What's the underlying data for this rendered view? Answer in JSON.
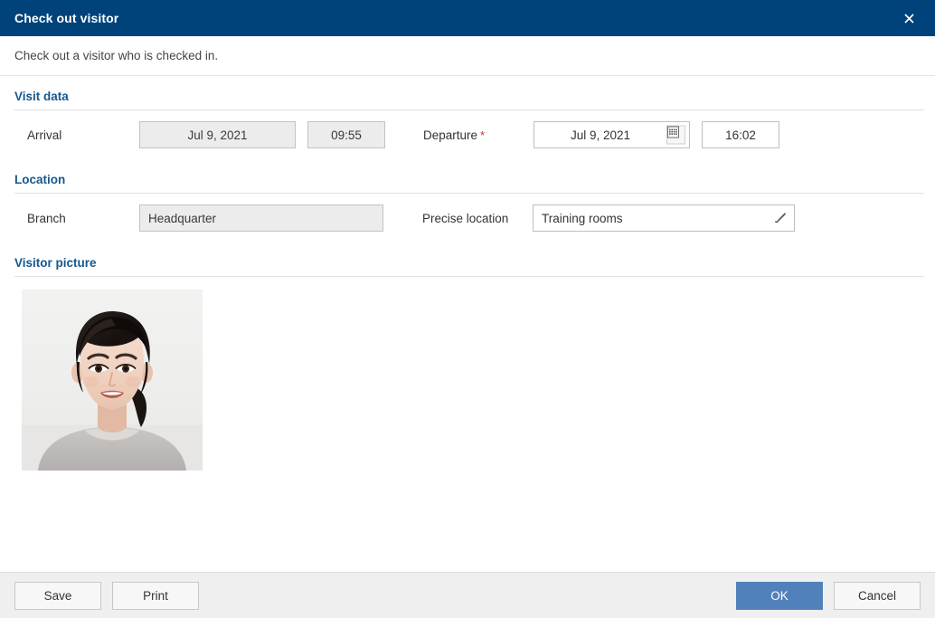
{
  "titlebar": {
    "title": "Check out visitor",
    "close_icon": "close-icon"
  },
  "subheader": {
    "text": "Check out a visitor who is checked in."
  },
  "sections": {
    "visit_data": {
      "title": "Visit data",
      "arrival": {
        "label": "Arrival",
        "date_value": "Jul 9, 2021",
        "time_value": "09:55"
      },
      "departure": {
        "label": "Departure",
        "required_marker": "*",
        "date_value": "Jul 9, 2021",
        "time_value": "16:02",
        "calendar_icon": "calendar-icon"
      }
    },
    "location": {
      "title": "Location",
      "branch": {
        "label": "Branch",
        "value": "Headquarter"
      },
      "precise_location": {
        "label": "Precise location",
        "value": "Training rooms",
        "edit_icon": "pencil-icon"
      }
    },
    "visitor_picture": {
      "title": "Visitor picture"
    }
  },
  "footer": {
    "save_label": "Save",
    "print_label": "Print",
    "ok_label": "OK",
    "cancel_label": "Cancel"
  },
  "colors": {
    "titlebar_bg": "#00427a",
    "section_heading": "#15578f",
    "primary_button": "#5181ba",
    "required_star": "#c0392b",
    "disabled_field_bg": "#ececec",
    "footer_bg": "#efefef"
  }
}
